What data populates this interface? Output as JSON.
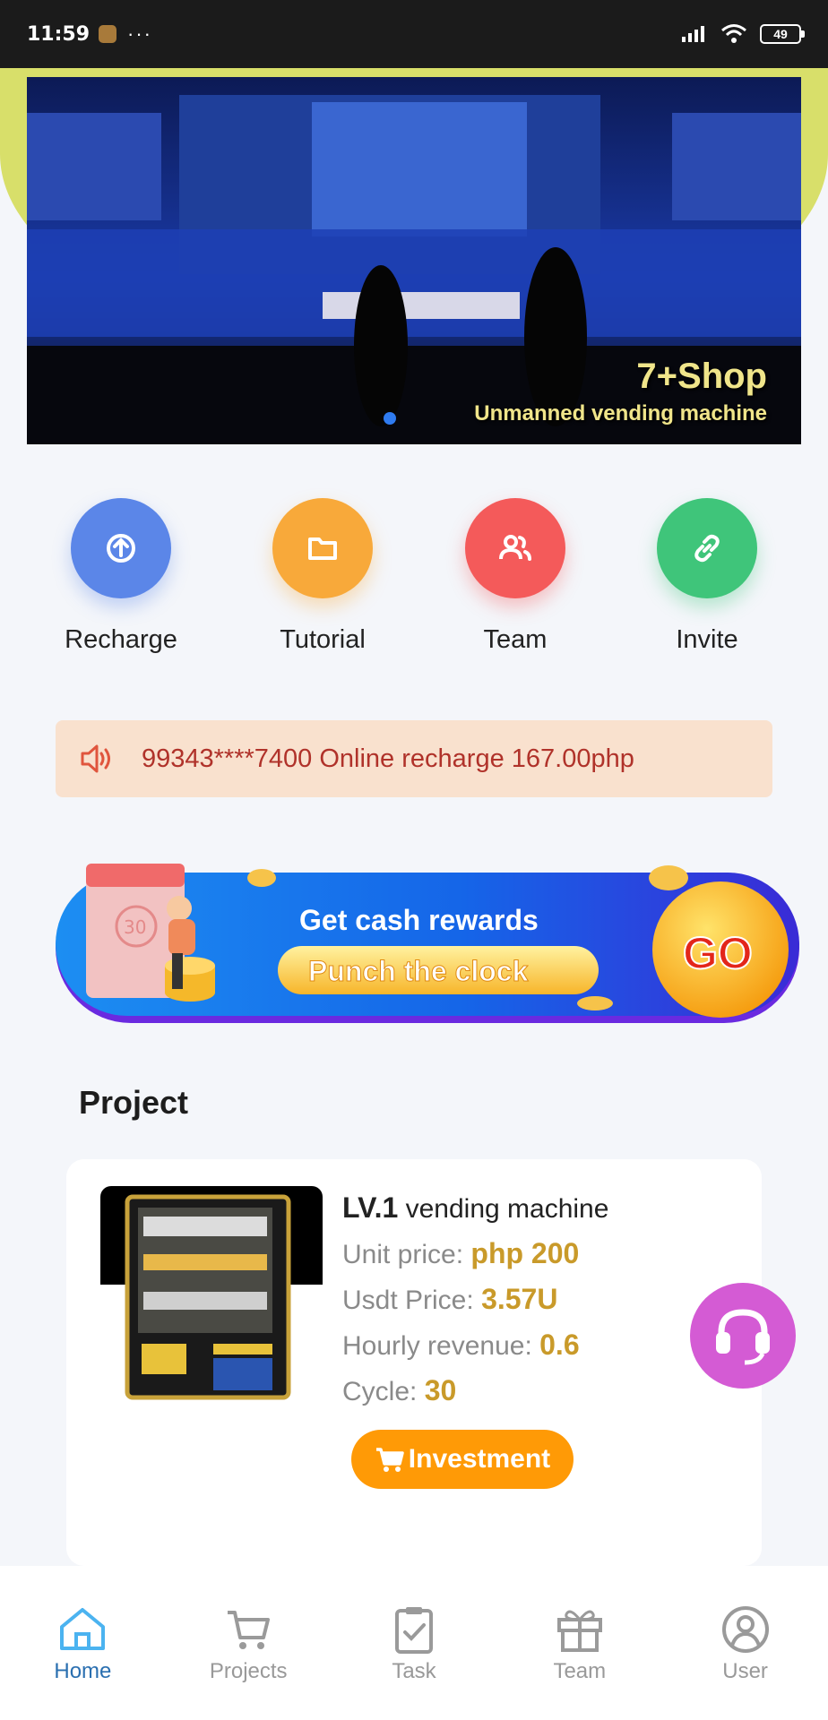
{
  "status_bar": {
    "time": "11:59",
    "dots": "···",
    "battery": "49"
  },
  "banner": {
    "title": "7+Shop",
    "subtitle": "Unmanned vending machine"
  },
  "quick_actions": [
    {
      "label": "Recharge",
      "icon": "upload-icon",
      "color": "#5b86e8"
    },
    {
      "label": "Tutorial",
      "icon": "folder-icon",
      "color": "#f8a93a"
    },
    {
      "label": "Team",
      "icon": "users-icon",
      "color": "#f45a5a"
    },
    {
      "label": "Invite",
      "icon": "link-icon",
      "color": "#3fc57a"
    }
  ],
  "notice": {
    "text": "99343****7400 Online recharge 167.00php",
    "icon": "speaker-icon"
  },
  "punch": {
    "headline": "Get cash rewards",
    "button": "Punch the clock",
    "go": "GO",
    "calendar_day": "30"
  },
  "project": {
    "section_title": "Project",
    "name_level": "LV.1",
    "name_rest": "vending machine",
    "unit_price_label": "Unit price:",
    "unit_price": "php 200",
    "usdt_label": "Usdt Price:",
    "usdt": "3.57U",
    "hourly_label": "Hourly revenue:",
    "hourly": "0.6",
    "cycle_label": "Cycle:",
    "cycle": "30",
    "button": "Investment"
  },
  "bottom_nav": [
    {
      "label": "Home",
      "icon": "home-icon",
      "active": true
    },
    {
      "label": "Projects",
      "icon": "cart-icon",
      "active": false
    },
    {
      "label": "Task",
      "icon": "clipboard-check-icon",
      "active": false
    },
    {
      "label": "Team",
      "icon": "gift-icon",
      "active": false
    },
    {
      "label": "User",
      "icon": "user-icon",
      "active": false
    }
  ],
  "colors": {
    "accent": "#2a6fb0",
    "invest": "#ff9a06",
    "price": "#c99a2a",
    "notice_bg": "#f9e1ce",
    "notice_text": "#b0322a"
  }
}
